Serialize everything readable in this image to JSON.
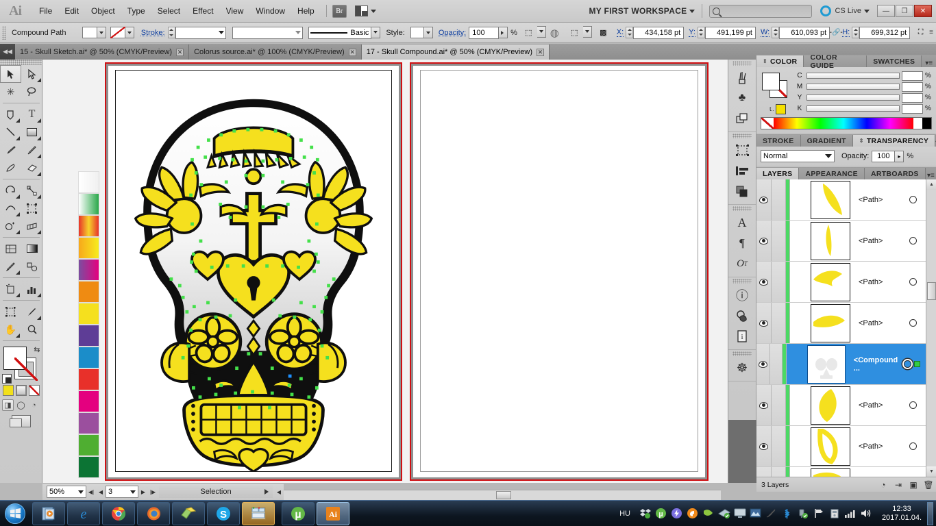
{
  "app": {
    "logo": "Ai",
    "menu": [
      "File",
      "Edit",
      "Object",
      "Type",
      "Select",
      "Effect",
      "View",
      "Window",
      "Help"
    ],
    "bridge_label": "Br",
    "workspace": "MY FIRST WORKSPACE",
    "cs_live": "CS Live",
    "search_placeholder": "",
    "window_buttons": {
      "minimize": "—",
      "restore": "❐",
      "close": "✕"
    }
  },
  "control_bar": {
    "object_type": "Compound Path",
    "stroke_label": "Stroke:",
    "stroke_weight": "",
    "brush_definition": "Basic",
    "style_label": "Style:",
    "opacity_label": "Opacity:",
    "opacity_value": "100",
    "percent": "%",
    "x_label": "X:",
    "x_value": "434,158 pt",
    "y_label": "Y:",
    "y_value": "491,199 pt",
    "w_label": "W:",
    "w_value": "610,093 pt",
    "h_label": "H:",
    "h_value": "699,312 pt"
  },
  "tabs": [
    {
      "title": "15 - Skull Sketch.ai* @ 50% (CMYK/Preview)",
      "active": false,
      "close": "✕"
    },
    {
      "title": "Colorus source.ai* @ 100% (CMYK/Preview)",
      "active": false,
      "close": "✕"
    },
    {
      "title": "17 - Skull Compound.ai* @ 50% (CMYK/Preview)",
      "active": true,
      "close": "✕"
    }
  ],
  "toolbar": {
    "tools": [
      {
        "name": "selection-tool",
        "glyph": "➤",
        "selected": true,
        "corner": false
      },
      {
        "name": "direct-selection-tool",
        "glyph": "➢",
        "selected": false,
        "corner": true
      },
      {
        "name": "magic-wand-tool",
        "glyph": "✳",
        "selected": false,
        "corner": false
      },
      {
        "name": "lasso-tool",
        "glyph": "☌",
        "selected": false,
        "corner": false
      },
      {
        "name": "pen-tool",
        "glyph": "✒",
        "selected": false,
        "corner": true
      },
      {
        "name": "type-tool",
        "glyph": "T",
        "selected": false,
        "corner": true
      },
      {
        "name": "line-segment-tool",
        "glyph": "╲",
        "selected": false,
        "corner": true
      },
      {
        "name": "rectangle-tool",
        "glyph": "▭",
        "selected": false,
        "corner": true
      },
      {
        "name": "paintbrush-tool",
        "glyph": "🖌",
        "selected": false,
        "corner": false
      },
      {
        "name": "pencil-tool",
        "glyph": "✎",
        "selected": false,
        "corner": true
      },
      {
        "name": "blob-brush-tool",
        "glyph": "◗",
        "selected": false,
        "corner": false
      },
      {
        "name": "eraser-tool",
        "glyph": "▱",
        "selected": false,
        "corner": true
      },
      {
        "name": "rotate-tool",
        "glyph": "↻",
        "selected": false,
        "corner": true
      },
      {
        "name": "scale-tool",
        "glyph": "⤡",
        "selected": false,
        "corner": true
      },
      {
        "name": "width-tool",
        "glyph": "≈",
        "selected": false,
        "corner": true
      },
      {
        "name": "free-transform-tool",
        "glyph": "⬚",
        "selected": false,
        "corner": false
      },
      {
        "name": "shape-builder-tool",
        "glyph": "◑",
        "selected": false,
        "corner": true
      },
      {
        "name": "perspective-grid-tool",
        "glyph": "▦",
        "selected": false,
        "corner": true
      },
      {
        "name": "mesh-tool",
        "glyph": "▩",
        "selected": false,
        "corner": false
      },
      {
        "name": "gradient-tool",
        "glyph": "▤",
        "selected": false,
        "corner": false
      },
      {
        "name": "eyedropper-tool",
        "glyph": "⚲",
        "selected": false,
        "corner": true
      },
      {
        "name": "blend-tool",
        "glyph": "❂",
        "selected": false,
        "corner": false
      },
      {
        "name": "symbol-sprayer-tool",
        "glyph": "⚗",
        "selected": false,
        "corner": true
      },
      {
        "name": "column-graph-tool",
        "glyph": "▊",
        "selected": false,
        "corner": true
      },
      {
        "name": "artboard-tool",
        "glyph": "⬛",
        "selected": false,
        "corner": false
      },
      {
        "name": "slice-tool",
        "glyph": "✂",
        "selected": false,
        "corner": true
      },
      {
        "name": "hand-tool",
        "glyph": "✋",
        "selected": false,
        "corner": true
      },
      {
        "name": "zoom-tool",
        "glyph": "🔍",
        "selected": false,
        "corner": false
      }
    ],
    "fill_color": "#ffffff",
    "stroke_color": "none",
    "quick_fill": "#f2e01a",
    "screen_mode": "normal"
  },
  "swatch_strip": [
    {
      "name": "white-gradient",
      "css": "linear-gradient(to right,#ffffff,#f0f0f0)"
    },
    {
      "name": "green-gradient",
      "css": "linear-gradient(to right,#ffffff,#2aa84a)"
    },
    {
      "name": "red-yellow-gradient",
      "css": "linear-gradient(to right,#e8332a,#f6d32b,#e8332a)"
    },
    {
      "name": "orange-yellow-gradient",
      "css": "linear-gradient(to right,#f7a81b,#f7ec1e)"
    },
    {
      "name": "purple-magenta-gradient",
      "css": "linear-gradient(to right,#7b4ea0,#e4007f)"
    },
    {
      "name": "orange-solid",
      "css": "#ef8b12"
    },
    {
      "name": "yellow-solid",
      "css": "#f5e01e"
    },
    {
      "name": "purple-solid",
      "css": "#5e3d96"
    },
    {
      "name": "blue-solid",
      "css": "#1b8dc9"
    },
    {
      "name": "red-solid",
      "css": "#e8302a"
    },
    {
      "name": "pink-solid",
      "css": "#e4007f"
    },
    {
      "name": "violet-solid",
      "css": "#9b4f9e"
    },
    {
      "name": "green-solid",
      "css": "#4fae31"
    },
    {
      "name": "darkgreen-solid",
      "css": "#0c7434"
    }
  ],
  "status_bar": {
    "zoom": "50%",
    "page": "3",
    "mode": "Selection"
  },
  "dock_icons": [
    {
      "name": "brushes-icon",
      "glyph": "❦"
    },
    {
      "name": "symbols-icon",
      "glyph": "♣"
    },
    {
      "name": "layers-stack-icon",
      "glyph": "❐"
    },
    {
      "name": "artboards-icon",
      "glyph": "⬚"
    },
    {
      "name": "align-icon",
      "glyph": "▤"
    },
    {
      "name": "pathfinder-icon",
      "glyph": "❏"
    },
    {
      "name": "character-icon",
      "glyph": "A"
    },
    {
      "name": "paragraph-icon",
      "glyph": "¶"
    },
    {
      "name": "opentype-icon",
      "glyph": "O"
    },
    {
      "name": "info-icon",
      "glyph": "ⓘ"
    },
    {
      "name": "appearance-icon",
      "glyph": "◕"
    },
    {
      "name": "document-info-icon",
      "glyph": "🛈"
    },
    {
      "name": "navigator-icon",
      "glyph": "☸"
    }
  ],
  "color_panel": {
    "tabs": [
      {
        "label": "COLOR",
        "active": true
      },
      {
        "label": "COLOR GUIDE",
        "active": false
      },
      {
        "label": "SWATCHES",
        "active": false
      }
    ],
    "sliders": [
      {
        "label": "C",
        "value": "",
        "unit": "%"
      },
      {
        "label": "M",
        "value": "",
        "unit": "%"
      },
      {
        "label": "Y",
        "value": "",
        "unit": "%"
      },
      {
        "label": "K",
        "value": "",
        "unit": "%"
      }
    ],
    "temp_swatch_label": "t..",
    "temp_swatch_color": "#f5e000"
  },
  "transparency_panel": {
    "tabs": [
      {
        "label": "STROKE",
        "active": false
      },
      {
        "label": "GRADIENT",
        "active": false
      },
      {
        "label": "TRANSPARENCY",
        "active": true
      }
    ],
    "blend_mode": "Normal",
    "opacity_label": "Opacity:",
    "opacity_value": "100",
    "percent": "%"
  },
  "layers_panel": {
    "tabs": [
      {
        "label": "LAYERS",
        "active": true
      },
      {
        "label": "APPEARANCE",
        "active": false
      },
      {
        "label": "ARTBOARDS",
        "active": false
      }
    ],
    "layer_color": "#4cd964",
    "rows": [
      {
        "name": "<Path>",
        "selected": false,
        "thumb": "path-a"
      },
      {
        "name": "<Path>",
        "selected": false,
        "thumb": "path-b"
      },
      {
        "name": "<Path>",
        "selected": false,
        "thumb": "path-c"
      },
      {
        "name": "<Path>",
        "selected": false,
        "thumb": "path-d"
      },
      {
        "name": "<Compound ...",
        "selected": true,
        "thumb": "compound-skull"
      },
      {
        "name": "<Path>",
        "selected": false,
        "thumb": "path-e"
      },
      {
        "name": "<Path>",
        "selected": false,
        "thumb": "path-f"
      },
      {
        "name": "<Path>",
        "selected": false,
        "thumb": "path-g"
      }
    ],
    "footer_count": "3 Layers",
    "footer_buttons": [
      {
        "name": "make-clipping-mask-button",
        "glyph": "◔"
      },
      {
        "name": "create-new-sublayer-button",
        "glyph": "⇥"
      },
      {
        "name": "create-new-layer-button",
        "glyph": "▣"
      },
      {
        "name": "delete-selection-button",
        "glyph": "🗑"
      }
    ]
  },
  "taskbar": {
    "start_glyph": "⊞",
    "buttons": [
      {
        "name": "taskbar-media-player",
        "glyph": "▶",
        "style": "normal"
      },
      {
        "name": "taskbar-internet-explorer",
        "glyph": "e",
        "style": "normal"
      },
      {
        "name": "taskbar-chrome",
        "glyph": "◉",
        "style": "normal"
      },
      {
        "name": "taskbar-firefox",
        "glyph": "🦊",
        "style": "normal"
      },
      {
        "name": "taskbar-sticky-notes",
        "glyph": "▰",
        "style": "normal"
      },
      {
        "name": "taskbar-skype",
        "glyph": "S",
        "style": "normal"
      },
      {
        "name": "taskbar-total-commander",
        "glyph": "▤",
        "style": "highlight"
      },
      {
        "name": "taskbar-utorrent",
        "glyph": "µ",
        "style": "active-sep"
      },
      {
        "name": "taskbar-illustrator",
        "glyph": "Ai",
        "style": "active"
      }
    ],
    "language": "HU",
    "tray_icons": [
      {
        "name": "dropbox-tray-icon",
        "glyph": "❖"
      },
      {
        "name": "utorrent-tray-icon",
        "glyph": "µ"
      },
      {
        "name": "flash-tray-icon",
        "glyph": "⚡"
      },
      {
        "name": "avast-tray-icon",
        "glyph": "◉"
      },
      {
        "name": "shield-tray-icon",
        "glyph": "✔"
      },
      {
        "name": "update-tray-icon",
        "glyph": "⬓"
      },
      {
        "name": "display-tray-icon",
        "glyph": "🖥"
      },
      {
        "name": "nvidia-tray-icon",
        "glyph": "▣"
      },
      {
        "name": "sync-tray-icon",
        "glyph": "✎"
      },
      {
        "name": "bluetooth-tray-icon",
        "glyph": "ᛒ"
      },
      {
        "name": "usb-tray-icon",
        "glyph": "⚲"
      },
      {
        "name": "action-center-tray-icon",
        "glyph": "⚑"
      },
      {
        "name": "removable-media-tray-icon",
        "glyph": "⎘"
      },
      {
        "name": "network-tray-icon",
        "glyph": "▁▃▅"
      },
      {
        "name": "volume-tray-icon",
        "glyph": "🔊"
      }
    ],
    "time": "12:33",
    "date": "2017.01.04."
  },
  "artwork": {
    "title": "sugar-skull-vector",
    "fill_color": "#f5e01e",
    "outline_color": "#111111",
    "anchor_color": "#44e04a"
  }
}
